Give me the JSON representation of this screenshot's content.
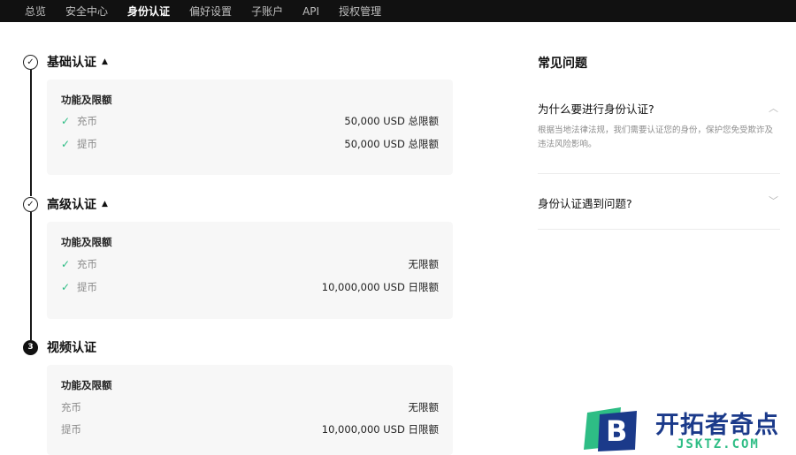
{
  "nav": {
    "items": [
      "总览",
      "安全中心",
      "身份认证",
      "偏好设置",
      "子账户",
      "API",
      "授权管理"
    ],
    "active_index": 2
  },
  "steps": [
    {
      "step_marker": "✓",
      "title": "基础认证",
      "caret": "▲",
      "card_title": "功能及限额",
      "rows": [
        {
          "icon": "✓",
          "label": "充币",
          "value": "50,000 USD 总限额"
        },
        {
          "icon": "✓",
          "label": "提币",
          "value": "50,000 USD 总限额"
        }
      ]
    },
    {
      "step_marker": "✓",
      "title": "高级认证",
      "caret": "▲",
      "card_title": "功能及限额",
      "rows": [
        {
          "icon": "✓",
          "label": "充币",
          "value": "无限额"
        },
        {
          "icon": "✓",
          "label": "提币",
          "value": "10,000,000 USD 日限额"
        }
      ]
    },
    {
      "step_marker": "3",
      "title": "视频认证",
      "card_title": "功能及限额",
      "rows": [
        {
          "label": "充币",
          "value": "无限额"
        },
        {
          "label": "提币",
          "value": "10,000,000 USD 日限额"
        }
      ]
    }
  ],
  "faq": {
    "heading": "常见问题",
    "items": [
      {
        "question": "为什么要进行身份认证?",
        "answer_line1": "根据当地法律法规，我们需要认证您的身份，保护您免受欺诈及",
        "answer_line2": "违法风险影响。",
        "chevron": "︿"
      },
      {
        "question": "身份认证遇到问题?",
        "chevron": "﹀"
      }
    ]
  },
  "watermark": {
    "mark_letter": "B",
    "brand": "开拓者奇点",
    "domain": "JSKTZ.COM",
    "colors": {
      "green": "#2ebd85",
      "blue": "#1b3a8a"
    }
  }
}
